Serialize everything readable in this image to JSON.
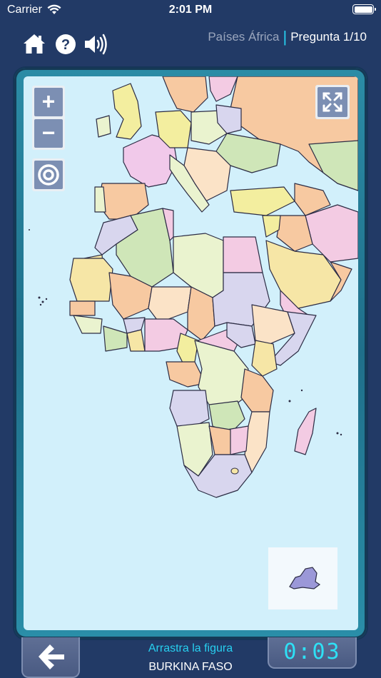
{
  "status_bar": {
    "carrier": "Carrier",
    "time": "2:01 PM"
  },
  "toolbar": {
    "icons": [
      "home-icon",
      "help-icon",
      "speaker-icon"
    ],
    "category": "Países África",
    "separator": "|",
    "question": "Pregunta 1/10"
  },
  "map": {
    "zoom_in": "+",
    "zoom_out": "−",
    "ocean_color": "#d2f0fb",
    "border_color": "#2c2c44"
  },
  "piece": {
    "name": "BURKINA FASO",
    "color": "#9b98d8"
  },
  "footer": {
    "instruction": "Arrastra la figura",
    "target": "BURKINA FASO",
    "timer": "0:03"
  },
  "colors": {
    "background": "#223a66",
    "accent": "#27d0f0",
    "button": "#7c8fb3"
  }
}
